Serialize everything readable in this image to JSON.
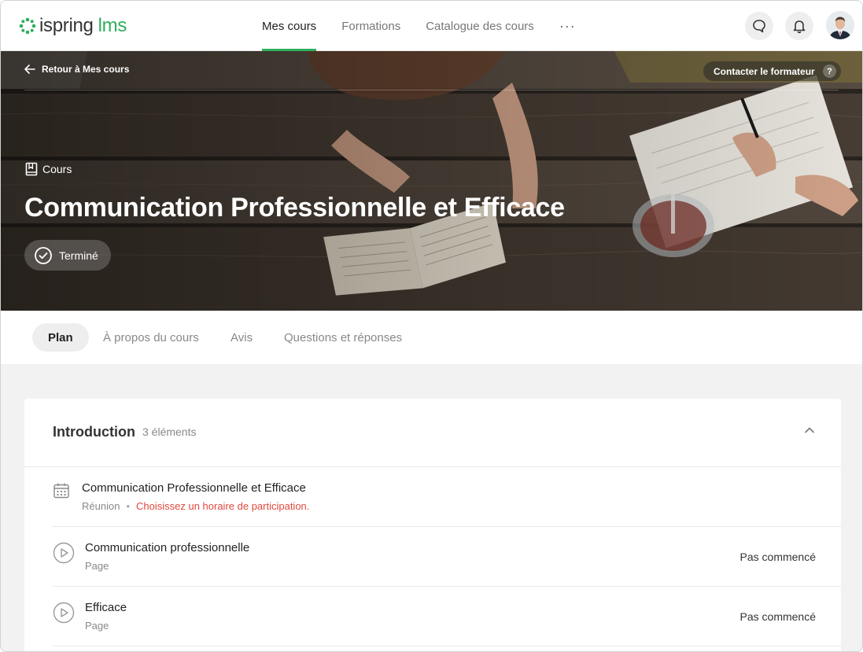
{
  "logo": {
    "text_main": "ispring",
    "text_accent": "lms"
  },
  "nav": {
    "items": [
      "Mes cours",
      "Formations",
      "Catalogue des cours"
    ],
    "more": "···"
  },
  "header_icons": [
    "chat-icon",
    "bell-icon",
    "avatar"
  ],
  "hero": {
    "back_label": "Retour à Mes cours",
    "contact_label": "Contacter le formateur",
    "help_glyph": "?",
    "type_label": "Cours",
    "title": "Communication Professionnelle et Efficace",
    "status": "Terminé"
  },
  "tabs": [
    "Plan",
    "À propos du cours",
    "Avis",
    "Questions et réponses"
  ],
  "section": {
    "title": "Introduction",
    "count": "3 éléments",
    "items": [
      {
        "title": "Communication Professionnelle et Efficace",
        "type": "Réunion",
        "note": "Choisissez un horaire de participation.",
        "status": "",
        "icon": "calendar-icon"
      },
      {
        "title": "Communication professionnelle",
        "type": "Page",
        "note": "",
        "status": "Pas commencé",
        "icon": "play-circle-icon"
      },
      {
        "title": "Efficace",
        "type": "Page",
        "note": "",
        "status": "Pas commencé",
        "icon": "play-circle-icon"
      }
    ]
  },
  "colors": {
    "accent": "#2fae5d",
    "warning": "#e0483d"
  }
}
